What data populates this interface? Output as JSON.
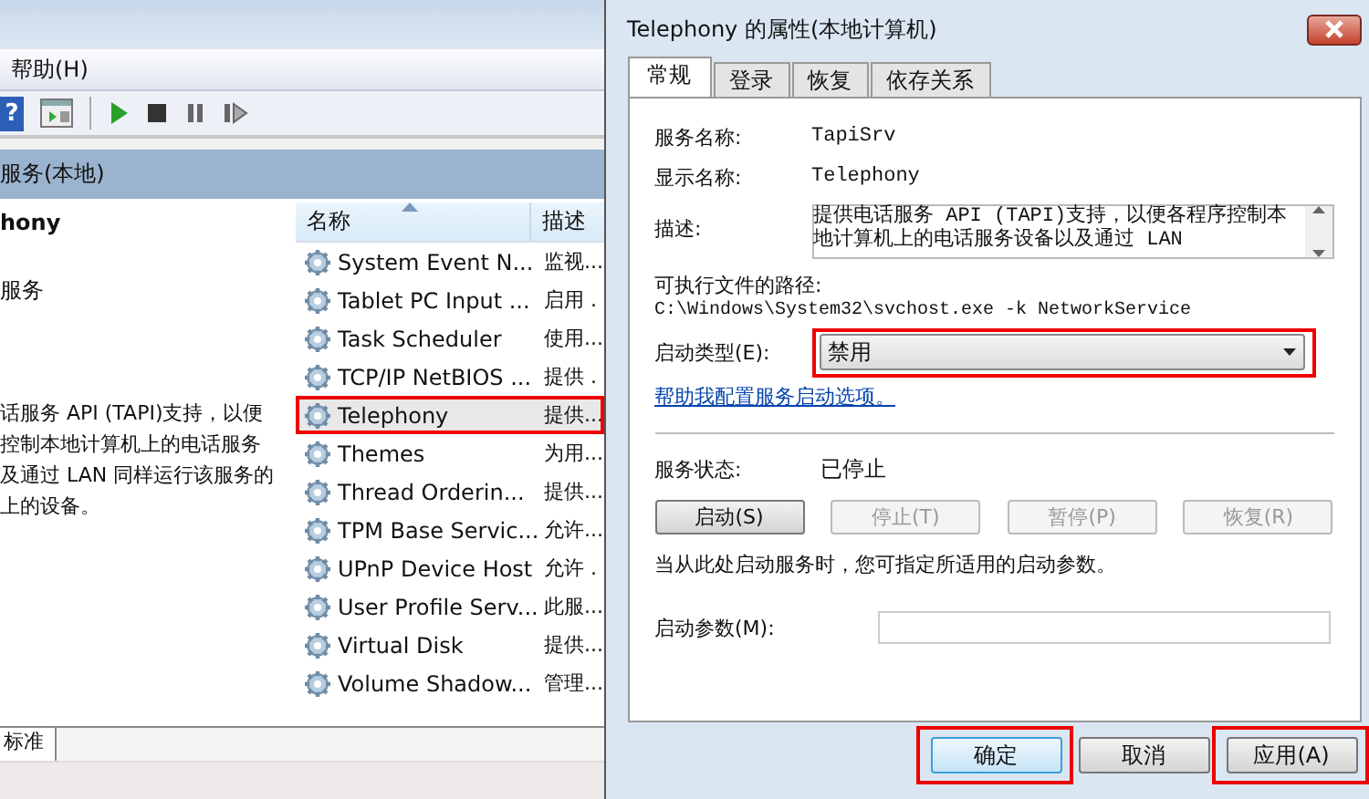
{
  "services_window": {
    "menu": [
      {
        "label": "帮助(H)"
      }
    ],
    "toolbar": {
      "help_glyph": "?"
    },
    "scope_header": "服务(本地)",
    "detail": {
      "title": "hony",
      "action": "服务",
      "description_lines": [
        "话服务 API (TAPI)支持，以便",
        "控制本地计算机上的电话服务",
        "及通过 LAN 同样运行该服务的",
        "上的设备。"
      ]
    },
    "list": {
      "columns": [
        "名称",
        "描述"
      ],
      "rows": [
        {
          "name": "System Event N...",
          "description": "监视...",
          "selected": false,
          "highlighted": false
        },
        {
          "name": "Tablet PC Input ...",
          "description": "启用 .",
          "selected": false,
          "highlighted": false
        },
        {
          "name": "Task Scheduler",
          "description": "使用...",
          "selected": false,
          "highlighted": false
        },
        {
          "name": "TCP/IP NetBIOS ...",
          "description": "提供 .",
          "selected": false,
          "highlighted": false
        },
        {
          "name": "Telephony",
          "description": "提供...",
          "selected": true,
          "highlighted": true
        },
        {
          "name": "Themes",
          "description": "为用...",
          "selected": false,
          "highlighted": false
        },
        {
          "name": "Thread Orderin...",
          "description": "提供...",
          "selected": false,
          "highlighted": false
        },
        {
          "name": "TPM Base Servic...",
          "description": "允许...",
          "selected": false,
          "highlighted": false
        },
        {
          "name": "UPnP Device Host",
          "description": "允许 .",
          "selected": false,
          "highlighted": false
        },
        {
          "name": "User Profile Serv...",
          "description": "此服...",
          "selected": false,
          "highlighted": false
        },
        {
          "name": "Virtual Disk",
          "description": "提供...",
          "selected": false,
          "highlighted": false
        },
        {
          "name": "Volume Shadow...",
          "description": "管理...",
          "selected": false,
          "highlighted": false
        }
      ]
    },
    "view_tabs": [
      {
        "label": "标准",
        "selected": true
      }
    ]
  },
  "dialog": {
    "title": "Telephony 的属性(本地计算机)",
    "tabs": [
      {
        "label": "常规",
        "selected": true
      },
      {
        "label": "登录",
        "selected": false
      },
      {
        "label": "恢复",
        "selected": false
      },
      {
        "label": "依存关系",
        "selected": false
      }
    ],
    "service_name": {
      "label": "服务名称:",
      "value": "TapiSrv"
    },
    "display_name": {
      "label": "显示名称:",
      "value": "Telephony"
    },
    "description": {
      "label": "描述:",
      "value": "提供电话服务 API (TAPI)支持，以便各程序控制本地计算机上的电话服务设备以及通过 LAN"
    },
    "path": {
      "label": "可执行文件的路径:",
      "value": "C:\\Windows\\System32\\svchost.exe -k NetworkService"
    },
    "startup_type": {
      "label": "启动类型(E):",
      "value": "禁用",
      "highlighted": true
    },
    "help_link": "帮助我配置服务启动选项。",
    "status": {
      "label": "服务状态:",
      "value": "已停止"
    },
    "control_buttons": [
      {
        "label": "启动(S)",
        "disabled": false
      },
      {
        "label": "停止(T)",
        "disabled": true
      },
      {
        "label": "暂停(P)",
        "disabled": true
      },
      {
        "label": "恢复(R)",
        "disabled": true
      }
    ],
    "hint": "当从此处启动服务时，您可指定所适用的启动参数。",
    "start_params": {
      "label": "启动参数(M):"
    },
    "buttons": [
      {
        "label": "确定",
        "default": true,
        "highlighted": true
      },
      {
        "label": "取消",
        "default": false,
        "highlighted": false
      },
      {
        "label": "应用(A)",
        "default": false,
        "highlighted": true
      }
    ]
  }
}
